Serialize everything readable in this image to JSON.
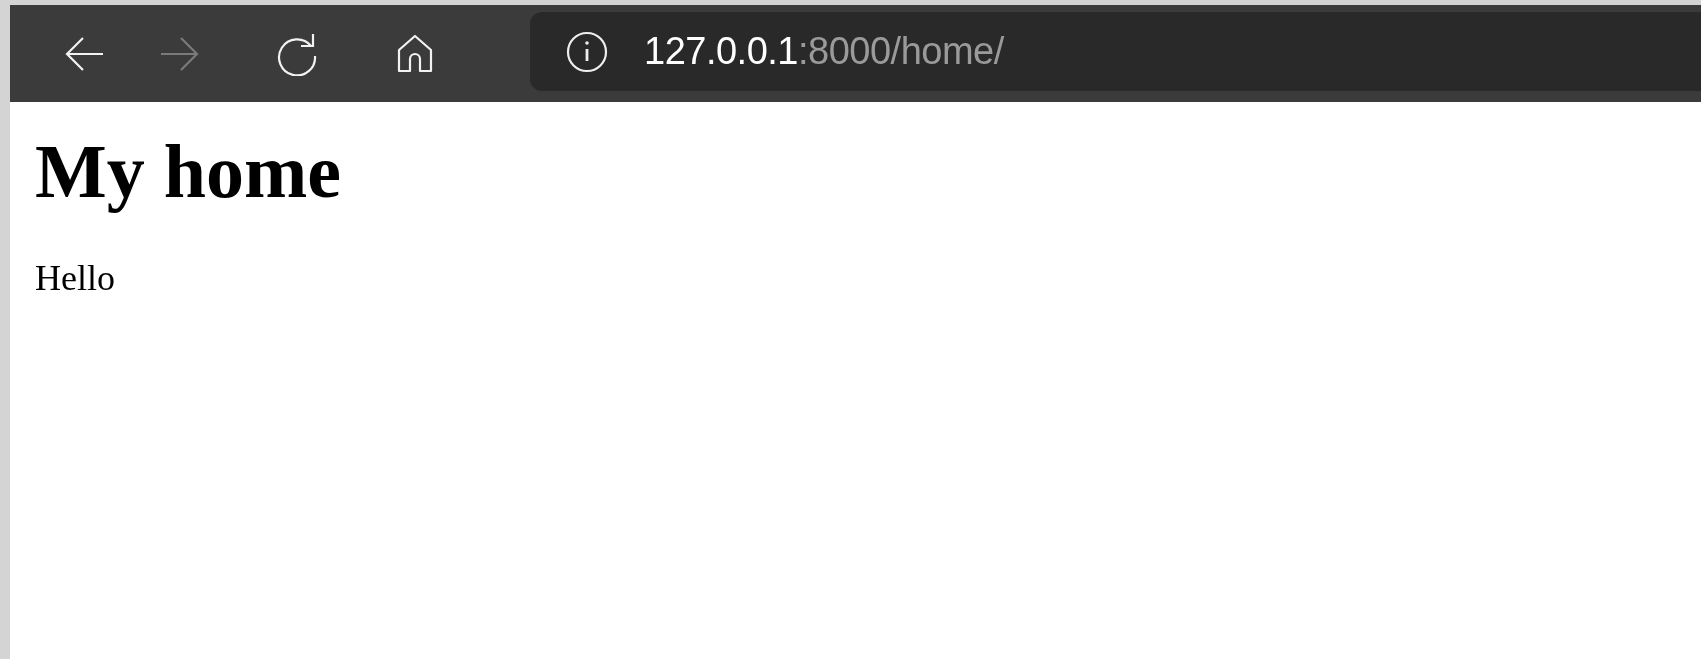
{
  "toolbar": {
    "buttons": [
      {
        "kind": "back",
        "disabled": false
      },
      {
        "kind": "forward",
        "disabled": true
      },
      {
        "kind": "reload",
        "disabled": false
      },
      {
        "kind": "home",
        "disabled": false
      }
    ],
    "address": {
      "host": "127.0.0.1",
      "path": ":8000/home/"
    }
  },
  "page": {
    "heading": "My home",
    "paragraph": "Hello"
  }
}
